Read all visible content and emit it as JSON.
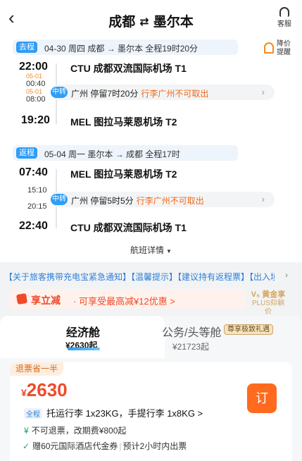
{
  "header": {
    "back_icon": "back-arrow-icon",
    "origin": "成都",
    "swap_icon": "⇄",
    "destination": "墨尔本",
    "service_label": "客服"
  },
  "outbound": {
    "tag": "去程",
    "info": "04-30 周四  成都 → 墨尔本  全程19时20分",
    "depart_time": "22:00",
    "depart_airport": "CTU 成都双流国际机场 T1",
    "transfer_arrive_date": "05-01",
    "transfer_arrive_time": "00:40",
    "transfer_depart_date": "05-01",
    "transfer_depart_time": "08:00",
    "transfer_tag": "中转",
    "transfer_text": "广州 停留7时20分",
    "transfer_warning": "行李广州不可取出",
    "arrive_time": "19:20",
    "arrive_airport": "MEL 图拉马莱恩机场 T2"
  },
  "price_alert": {
    "label_line1": "降价",
    "label_line2": "提醒"
  },
  "inbound": {
    "tag": "返程",
    "info": "05-04 周一  墨尔本 → 成都  全程17时",
    "depart_time": "07:40",
    "depart_airport": "MEL 图拉马莱恩机场 T2",
    "transfer_arrive_time": "15:10",
    "transfer_depart_time": "20:15",
    "transfer_tag": "中转",
    "transfer_text": "广州 停留5时5分",
    "transfer_warning": "行李广州不可取出",
    "arrive_time": "22:40",
    "arrive_airport": "CTU 成都双流国际机场 T1"
  },
  "details_link": "航班详情",
  "notice": "【关于旅客携带充电宝紧急通知】【温馨提示】【建议持有返程票】【出入境...",
  "promo": {
    "title": "享立减",
    "text": "· 可享受最高减¥12优惠 >",
    "plus_line1": "V₅ 黄金享",
    "plus_line2": "PLUS仰躺价"
  },
  "cabins": {
    "economy": {
      "name": "经济舱",
      "price": "¥2630起"
    },
    "business": {
      "name": "公务/头等舱",
      "badge": "尊享极致礼遇",
      "price": "¥21723起"
    }
  },
  "offer": {
    "tag": "退票省一半",
    "currency": "¥",
    "price": "2630",
    "book_label": "订",
    "scope_tag": "全程",
    "luggage": "托运行李 1x23KG，手提行李 1x8KG >",
    "refund_icon": "¥",
    "refund": "不可退票，改期费¥800起",
    "gift_icon": "✓",
    "gift": "赠60元国际酒店代金券",
    "gift_note": "预计2小时内出票"
  }
}
